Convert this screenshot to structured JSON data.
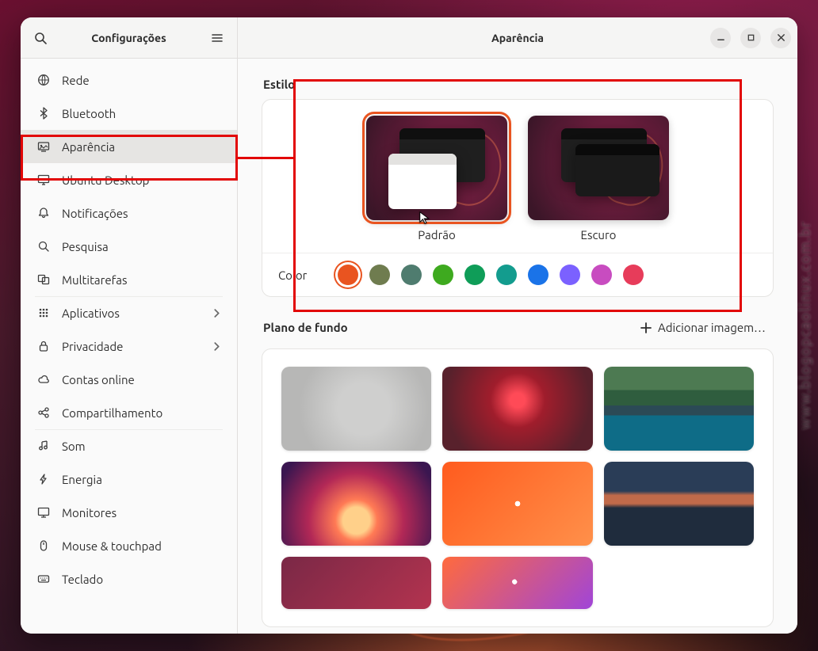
{
  "watermark": "www.blogopcaolinux.com.br",
  "titlebar": {
    "left_title": "Configurações",
    "right_title": "Aparência"
  },
  "sidebar": {
    "items": [
      {
        "key": "rede",
        "label": "Rede"
      },
      {
        "key": "bluetooth",
        "label": "Bluetooth"
      },
      {
        "key": "aparencia",
        "label": "Aparência"
      },
      {
        "key": "ubuntu-desktop",
        "label": "Ubuntu Desktop"
      },
      {
        "key": "notificacoes",
        "label": "Notificações"
      },
      {
        "key": "pesquisa",
        "label": "Pesquisa"
      },
      {
        "key": "multitarefas",
        "label": "Multitarefas"
      },
      {
        "key": "aplicativos",
        "label": "Aplicativos"
      },
      {
        "key": "privacidade",
        "label": "Privacidade"
      },
      {
        "key": "contas-online",
        "label": "Contas online"
      },
      {
        "key": "compartilhamento",
        "label": "Compartilhamento"
      },
      {
        "key": "som",
        "label": "Som"
      },
      {
        "key": "energia",
        "label": "Energia"
      },
      {
        "key": "monitores",
        "label": "Monitores"
      },
      {
        "key": "mouse-touchpad",
        "label": "Mouse & touchpad"
      },
      {
        "key": "teclado",
        "label": "Teclado"
      }
    ]
  },
  "style": {
    "section_title": "Estilo",
    "themes": [
      {
        "key": "padrao",
        "label": "Padrão",
        "selected": true,
        "variant": "light"
      },
      {
        "key": "escuro",
        "label": "Escuro",
        "selected": false,
        "variant": "dark"
      }
    ],
    "color_label": "Color",
    "colors": [
      {
        "hex": "#e95420",
        "selected": true
      },
      {
        "hex": "#6f7c4f",
        "selected": false
      },
      {
        "hex": "#4f7c6f",
        "selected": false
      },
      {
        "hex": "#3eaa1f",
        "selected": false
      },
      {
        "hex": "#0f9d58",
        "selected": false
      },
      {
        "hex": "#139c8e",
        "selected": false
      },
      {
        "hex": "#1a73e8",
        "selected": false
      },
      {
        "hex": "#7b61ff",
        "selected": false
      },
      {
        "hex": "#c84cc0",
        "selected": false
      },
      {
        "hex": "#e73c5a",
        "selected": false
      }
    ]
  },
  "wallpapers": {
    "section_title": "Plano de fundo",
    "add_label": "Adicionar imagem…",
    "items": [
      {
        "key": "wp-kudu-grey",
        "css": "background:radial-gradient(circle at 55% 50%, #cfcfce 0 28%, #b7b7b6 70%);"
      },
      {
        "key": "wp-kudu-red",
        "css": "background:radial-gradient(circle at 50% 40%, #ff4a57 0 8%, #a01d2c 30%, #58212c 80%);"
      },
      {
        "key": "wp-alps-lake",
        "css": "background:linear-gradient(180deg,#4d7a52 0 28%,#2f5d3e 28% 46%,#2b4a56 46% 58%,#0e6c87 58% 100%);"
      },
      {
        "key": "wp-sunset-kudu",
        "css": "background:radial-gradient(circle at 50% 70%, #ffd08a 0 14%, #ff7a55 22%, #b22856 50%, #3a1650 90%);"
      },
      {
        "key": "wp-ubuntu-logo",
        "css": "background:radial-gradient(circle at 50% 50%, #ffffff 0 3%, transparent 3%), linear-gradient(135deg,#ff5b1e 0%, #ff904a 100%);"
      },
      {
        "key": "wp-mountain-dusk",
        "css": "background:linear-gradient(180deg,#2a3d57 0 35%,#c06a4a 40% 50%,#1f2c3d 55% 100%);"
      },
      {
        "key": "wp-kudu-maroon",
        "css": "background:linear-gradient(135deg,#7a2846 0%, #b3334f 100%);"
      },
      {
        "key": "wp-ubuntu-purple",
        "css": "background:radial-gradient(circle at 48% 48%, #ffffff 0 3%, transparent 3%), linear-gradient(135deg,#ff6a3d 0%, #a045d8 100%);"
      }
    ]
  }
}
